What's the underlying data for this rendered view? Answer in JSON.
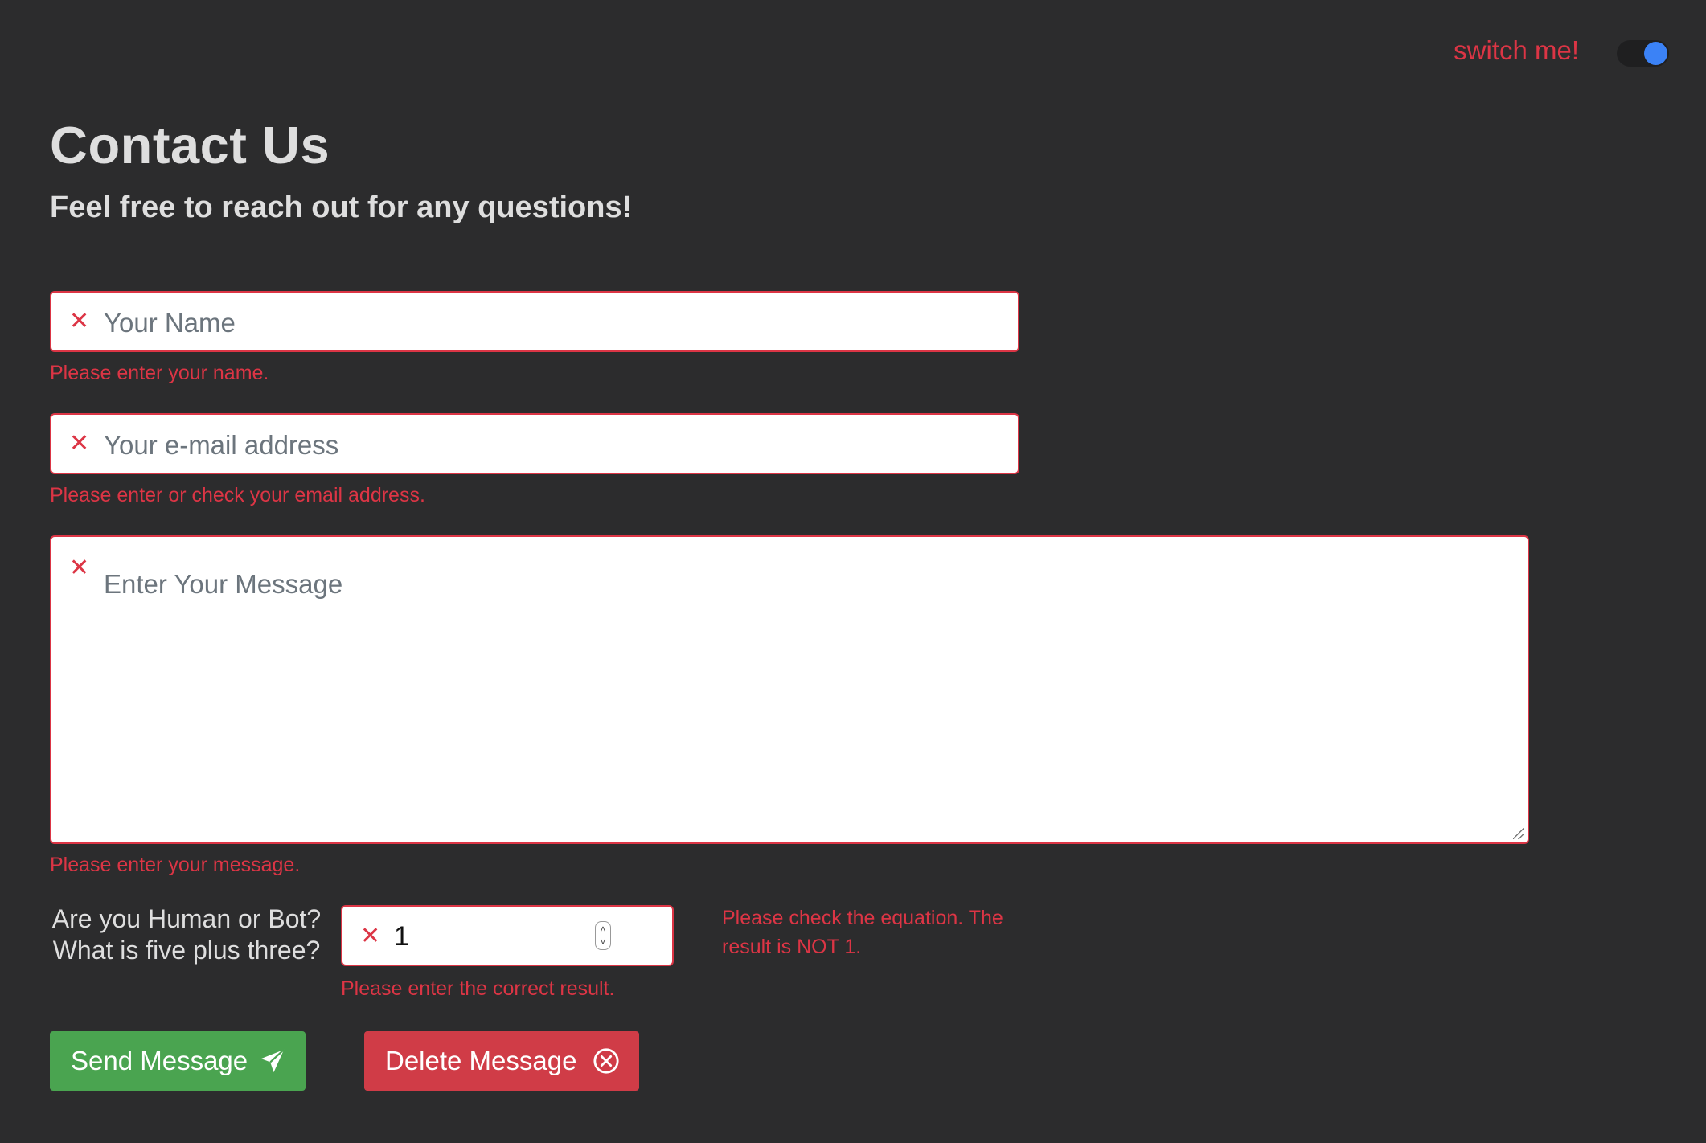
{
  "header": {
    "switch_label": "switch me!",
    "toggle_on": true
  },
  "intro": {
    "title": "Contact Us",
    "subtitle": "Feel free to reach out for any questions!"
  },
  "form": {
    "name": {
      "placeholder": "Your Name",
      "error": "Please enter your name."
    },
    "email": {
      "placeholder": "Your e-mail address",
      "error": "Please enter or check your email address."
    },
    "message": {
      "placeholder": "Enter Your Message",
      "error": "Please enter your message."
    },
    "captcha": {
      "question_line1": "Are you Human or Bot?",
      "question_line2": "What is five plus three?",
      "value": "1",
      "error": "Please enter the correct result.",
      "equation_error": "Please check the equation. The result is NOT 1."
    }
  },
  "buttons": {
    "send_label": "Send Message",
    "delete_label": "Delete Message"
  },
  "colors": {
    "background": "#2c2c2d",
    "error": "#dc3545",
    "send": "#4aa450",
    "delete": "#d03c47",
    "toggle_knob": "#3b82f6"
  },
  "icons": {
    "field_status": "x-icon",
    "send": "paper-plane-icon",
    "delete": "circle-x-icon"
  }
}
